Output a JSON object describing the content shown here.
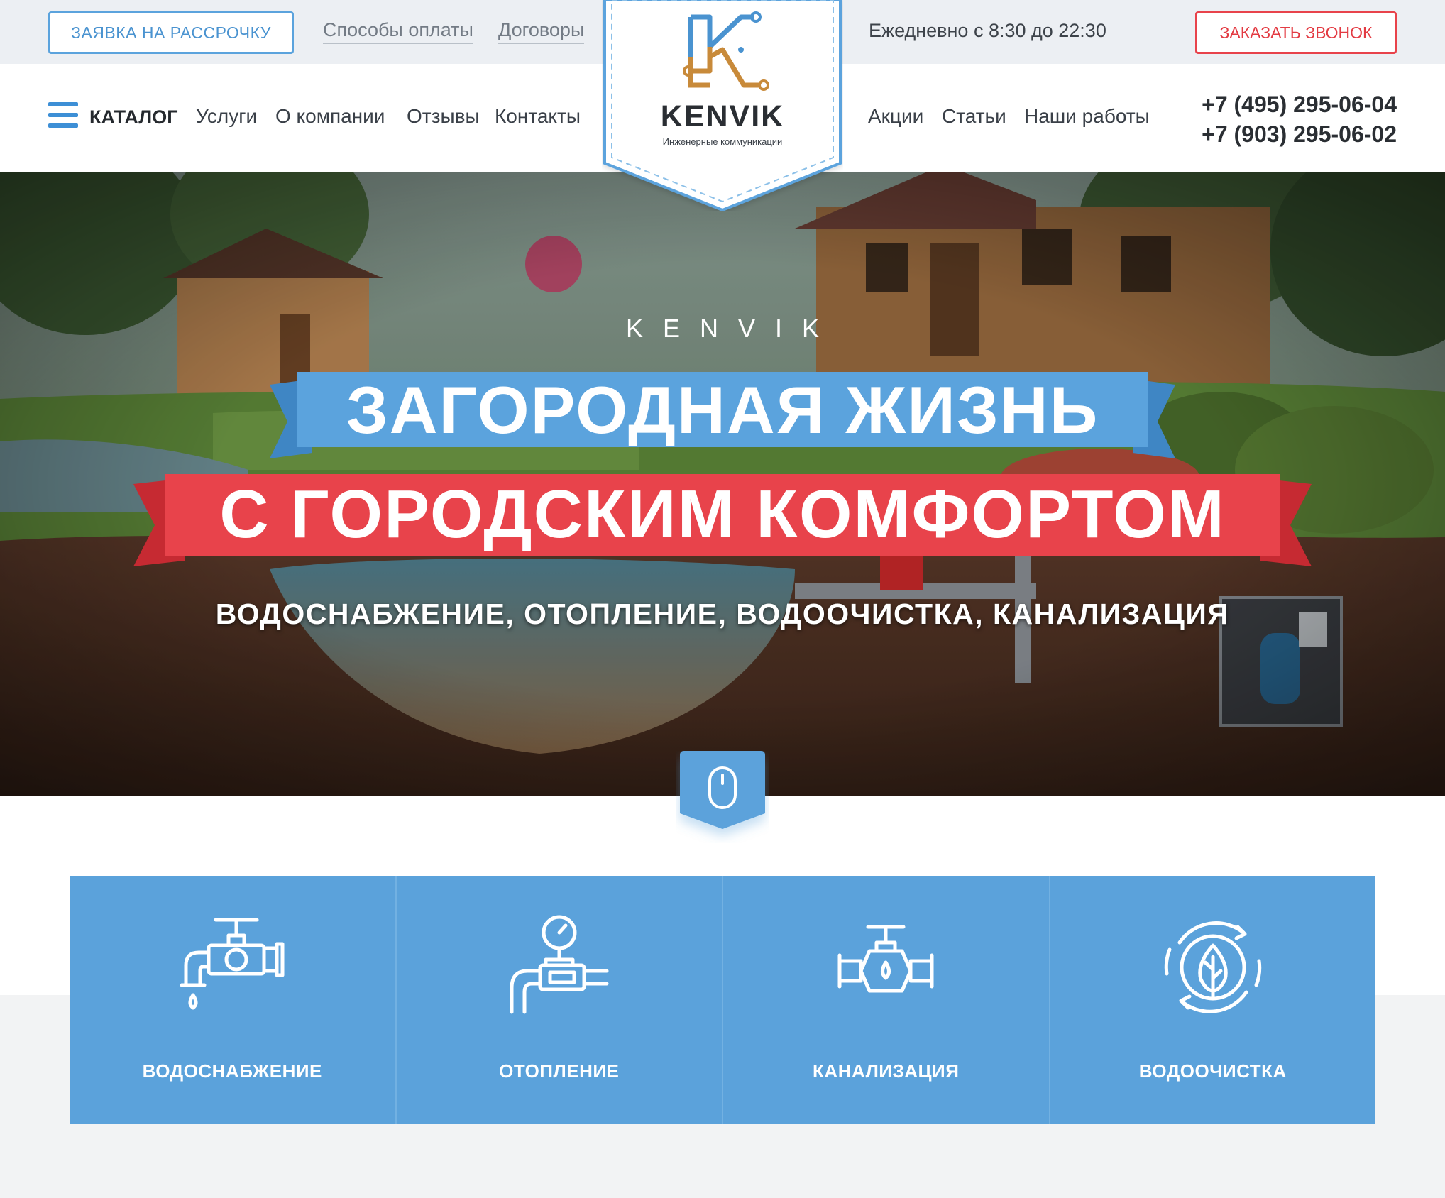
{
  "topbar": {
    "installment_label": "ЗАЯВКА НА РАССРОЧКУ",
    "payment_link": "Способы оплаты",
    "contracts_link": "Договоры",
    "hours": "Ежедневно с 8:30 до 22:30",
    "callback_label": "ЗАКАЗАТЬ ЗВОНОК"
  },
  "logo": {
    "name": "KENVIK",
    "tagline": "Инженерные коммуникации"
  },
  "nav": {
    "catalog": "КАТАЛОГ",
    "left_links": [
      "Услуги",
      "О компании",
      "Отзывы",
      "Контакты"
    ],
    "right_links": [
      "Акции",
      "Статьи",
      "Наши работы"
    ],
    "phones": [
      "+7 (495) 295-06-04",
      "+7 (903) 295-06-02"
    ]
  },
  "hero": {
    "brand": "KENVIK",
    "line1": "ЗАГОРОДНАЯ ЖИЗНЬ",
    "line2": "С ГОРОДСКИМ КОМФОРТОМ",
    "services": "ВОДОСНАБЖЕНИЕ, ОТОПЛЕНИЕ, ВОДООЧИСТКА, КАНАЛИЗАЦИЯ"
  },
  "services": [
    {
      "label": "ВОДОСНАБЖЕНИЕ",
      "icon": "water-tap-icon"
    },
    {
      "label": "ОТОПЛЕНИЕ",
      "icon": "pressure-gauge-pipe-icon"
    },
    {
      "label": "КАНАЛИЗАЦИЯ",
      "icon": "valve-drop-icon"
    },
    {
      "label": "ВОДООЧИСТКА",
      "icon": "leaf-drop-cycle-icon"
    }
  ],
  "colors": {
    "accent_blue": "#5ba2db",
    "accent_red": "#e8434b",
    "text_dark": "#2a2e33"
  }
}
